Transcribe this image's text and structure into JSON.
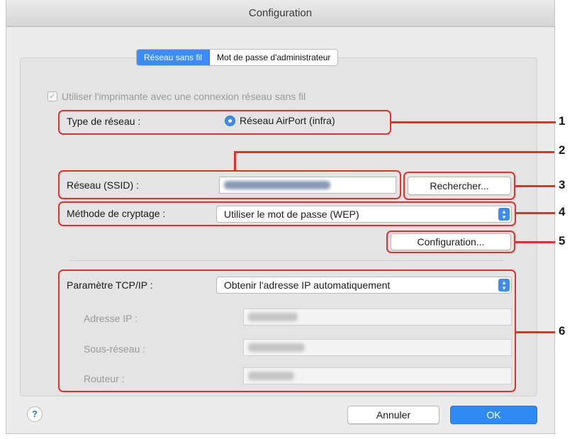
{
  "window": {
    "title": "Configuration"
  },
  "tabs": [
    {
      "label": "Réseau sans fil",
      "active": true
    },
    {
      "label": "Mot de passe d'administrateur",
      "active": false
    }
  ],
  "wireless_checkbox": {
    "label": "Utiliser l'imprimante avec une connexion réseau sans fil",
    "checked": true,
    "enabled": false
  },
  "network_type": {
    "label": "Type de réseau :",
    "option": "Réseau AirPort (infra)",
    "selected": true
  },
  "ssid": {
    "label": "Réseau (SSID) :",
    "search_button": "Rechercher..."
  },
  "encryption": {
    "label": "Méthode de cryptage :",
    "value": "Utiliser le mot de passe (WEP)",
    "config_button": "Configuration..."
  },
  "tcpip": {
    "label": "Paramètre TCP/IP :",
    "value": "Obtenir l'adresse IP automatiquement",
    "ip_label": "Adresse IP :",
    "subnet_label": "Sous-réseau :",
    "router_label": "Routeur :"
  },
  "footer": {
    "help": "?",
    "cancel": "Annuler",
    "ok": "OK"
  },
  "callouts": [
    "1",
    "2",
    "3",
    "4",
    "5",
    "6"
  ],
  "colors": {
    "accent": "#3b8df5",
    "callout": "#e0312b"
  }
}
